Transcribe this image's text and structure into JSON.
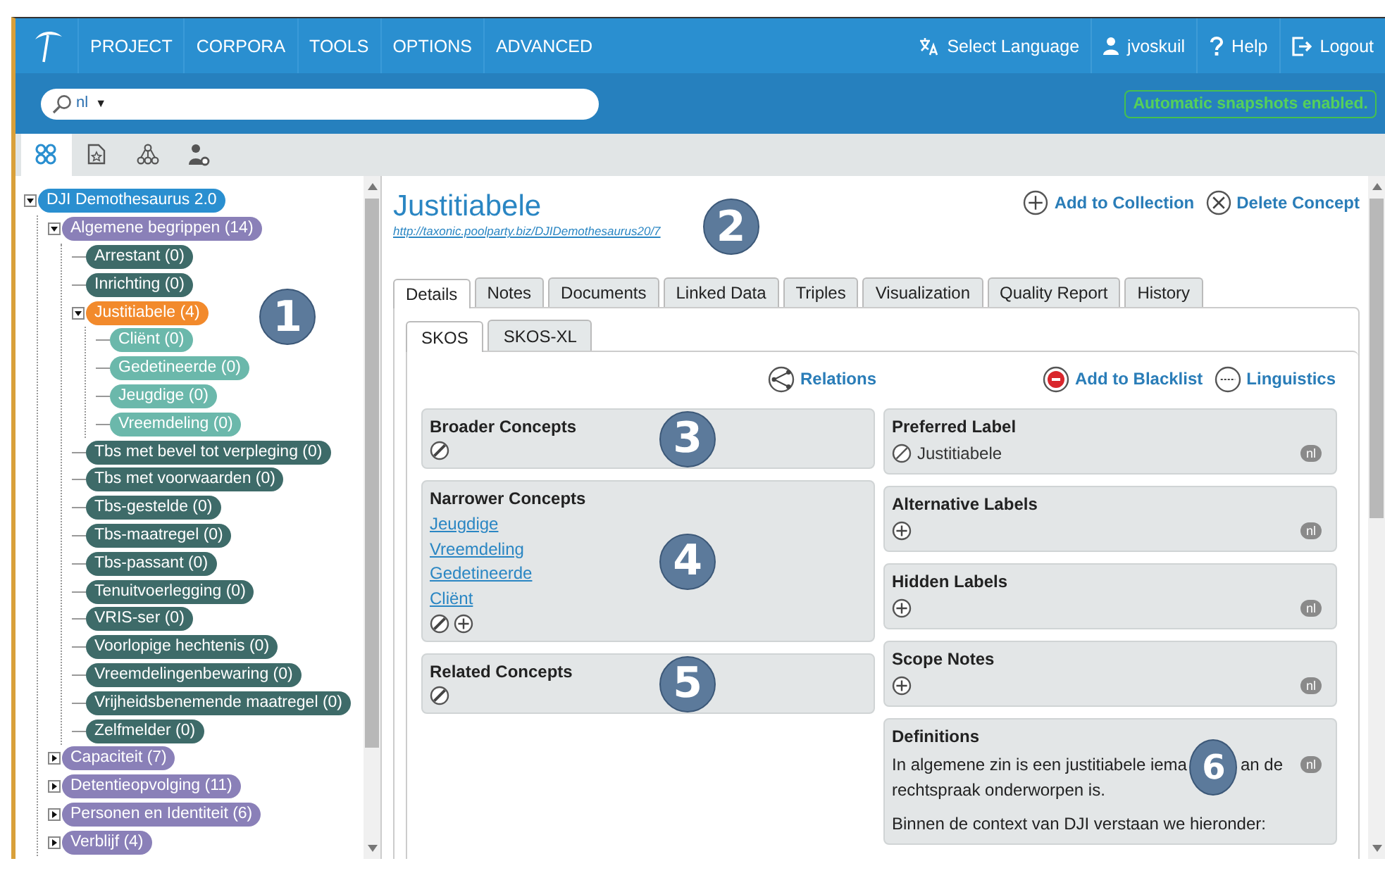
{
  "nav": {
    "menu": [
      "PROJECT",
      "CORPORA",
      "TOOLS",
      "OPTIONS",
      "ADVANCED"
    ],
    "right": [
      {
        "kind": "language",
        "label": "Select Language"
      },
      {
        "kind": "user",
        "label": "jvoskuil"
      },
      {
        "kind": "help",
        "label": "Help"
      },
      {
        "kind": "logout",
        "label": "Logout"
      }
    ]
  },
  "search": {
    "language": "nl",
    "dropdown": "▼"
  },
  "snapshot_notice": "Automatic snapshots enabled.",
  "view_tabs": [
    {
      "kind": "graph",
      "selected": true
    },
    {
      "kind": "document",
      "selected": false
    },
    {
      "kind": "hierarchy",
      "selected": false
    },
    {
      "kind": "user-settings",
      "selected": false
    }
  ],
  "tree": {
    "callout": "1",
    "nodes": [
      {
        "label": "DJI Demothesaurus 2.0",
        "color": "#2a8fd0",
        "expanded": true,
        "children": [
          {
            "label": "Algemene begrippen (14)",
            "color": "#8a80b8",
            "expanded": true,
            "children": [
              {
                "label": "Arrestant (0)",
                "color": "#3e6b69"
              },
              {
                "label": "Inrichting (0)",
                "color": "#3e6b69"
              },
              {
                "label": "Justitiabele (4)",
                "color": "#f28a2c",
                "expanded": true,
                "children": [
                  {
                    "label": "Cliënt (0)",
                    "color": "#6bb8ab"
                  },
                  {
                    "label": "Gedetineerde (0)",
                    "color": "#6bb8ab"
                  },
                  {
                    "label": "Jeugdige (0)",
                    "color": "#6bb8ab"
                  },
                  {
                    "label": "Vreemdeling (0)",
                    "color": "#6bb8ab"
                  }
                ]
              },
              {
                "label": "Tbs met bevel tot verpleging (0)",
                "color": "#3e6b69"
              },
              {
                "label": "Tbs met voorwaarden (0)",
                "color": "#3e6b69"
              },
              {
                "label": "Tbs-gestelde (0)",
                "color": "#3e6b69"
              },
              {
                "label": "Tbs-maatregel (0)",
                "color": "#3e6b69"
              },
              {
                "label": "Tbs-passant (0)",
                "color": "#3e6b69"
              },
              {
                "label": "Tenuitvoerlegging (0)",
                "color": "#3e6b69"
              },
              {
                "label": "VRIS-ser (0)",
                "color": "#3e6b69"
              },
              {
                "label": "Voorlopige hechtenis (0)",
                "color": "#3e6b69"
              },
              {
                "label": "Vreemdelingenbewaring (0)",
                "color": "#3e6b69"
              },
              {
                "label": "Vrijheidsbenemende maatregel (0)",
                "color": "#3e6b69"
              },
              {
                "label": "Zelfmelder (0)",
                "color": "#3e6b69"
              }
            ]
          },
          {
            "label": "Capaciteit (7)",
            "color": "#8a80b8",
            "expanded": false
          },
          {
            "label": "Detentieopvolging (11)",
            "color": "#8a80b8",
            "expanded": false
          },
          {
            "label": "Personen en Identiteit (6)",
            "color": "#8a80b8",
            "expanded": false
          },
          {
            "label": "Verblijf (4)",
            "color": "#8a80b8",
            "expanded": false
          }
        ]
      }
    ]
  },
  "concept": {
    "title": "Justitiabele",
    "uri": "http://taxonic.poolparty.biz/DJIDemothesaurus20/7",
    "callout": "2",
    "actions": [
      {
        "kind": "add",
        "label": "Add to Collection"
      },
      {
        "kind": "delete",
        "label": "Delete Concept"
      }
    ]
  },
  "tabs": [
    {
      "label": "Details",
      "selected": true
    },
    {
      "label": "Notes",
      "selected": false
    },
    {
      "label": "Documents",
      "selected": false
    },
    {
      "label": "Linked Data",
      "selected": false
    },
    {
      "label": "Triples",
      "selected": false
    },
    {
      "label": "Visualization",
      "selected": false
    },
    {
      "label": "Quality Report",
      "selected": false
    },
    {
      "label": "History",
      "selected": false
    }
  ],
  "subtabs": [
    {
      "label": "SKOS",
      "selected": true
    },
    {
      "label": "SKOS-XL",
      "selected": false
    }
  ],
  "tools": [
    {
      "kind": "relations",
      "label": "Relations"
    },
    {
      "kind": "blacklist",
      "label": "Add to Blacklist"
    },
    {
      "kind": "linguistics",
      "label": "Linguistics"
    }
  ],
  "relations": [
    {
      "title": "Broader Concepts",
      "callout": "3",
      "actions": [
        {
          "kind": "edit"
        }
      ]
    },
    {
      "title": "Narrower Concepts",
      "callout": "4",
      "links": [
        "Jeugdige",
        "Vreemdeling",
        "Gedetineerde",
        "Cliënt"
      ],
      "actions": [
        {
          "kind": "edit"
        },
        {
          "kind": "add"
        }
      ]
    },
    {
      "title": "Related Concepts",
      "callout": "5",
      "actions": [
        {
          "kind": "edit"
        }
      ]
    }
  ],
  "labels": [
    {
      "title": "Preferred Label",
      "action": {
        "kind": "blocked"
      },
      "value": "Justitiabele",
      "lang": "nl"
    },
    {
      "title": "Alternative Labels",
      "action": {
        "kind": "add"
      },
      "lang": "nl"
    },
    {
      "title": "Hidden Labels",
      "action": {
        "kind": "add"
      },
      "lang": "nl"
    },
    {
      "title": "Scope Notes",
      "action": {
        "kind": "add"
      },
      "lang": "nl"
    }
  ],
  "definitions": {
    "title": "Definitions",
    "lang": "nl",
    "text_before": "In algemene zin is een justitiabele iema",
    "callout": "6",
    "text_after": "an de",
    "line_2": "rechtspraak onderworpen is.",
    "paragraph_2": "Binnen de context van DJI verstaan we hieronder:"
  }
}
